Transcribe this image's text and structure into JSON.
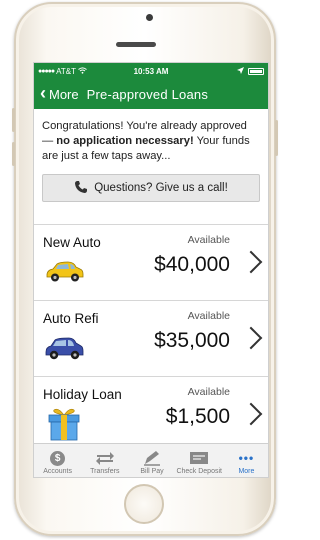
{
  "status_bar": {
    "carrier": "AT&T",
    "time": "10:53 AM"
  },
  "nav": {
    "back_label": "More",
    "title": "Pre-approved Loans"
  },
  "intro": {
    "text_start": "Congratulations! You're already approved —",
    "text_bold": "no application necessary!",
    "text_end": " Your funds are just a few taps away...",
    "call_button": "Questions? Give us a call!"
  },
  "loans": [
    {
      "name": "New Auto",
      "available_label": "Available",
      "amount": "$40,000",
      "icon": "yellow-car-icon"
    },
    {
      "name": "Auto Refi",
      "available_label": "Available",
      "amount": "$35,000",
      "icon": "blue-car-icon"
    },
    {
      "name": "Holiday Loan",
      "available_label": "Available",
      "amount": "$1,500",
      "icon": "gift-box-icon"
    }
  ],
  "tabs": [
    {
      "label": "Accounts",
      "icon": "dollar-coin-icon"
    },
    {
      "label": "Transfers",
      "icon": "transfer-arrows-icon"
    },
    {
      "label": "Bill Pay",
      "icon": "bill-pay-icon"
    },
    {
      "label": "Check Deposit",
      "icon": "check-deposit-icon"
    },
    {
      "label": "More",
      "icon": "more-dots-icon",
      "active": true
    }
  ],
  "colors": {
    "brand_green": "#1c8a3c",
    "active_tab": "#2a72c9"
  }
}
